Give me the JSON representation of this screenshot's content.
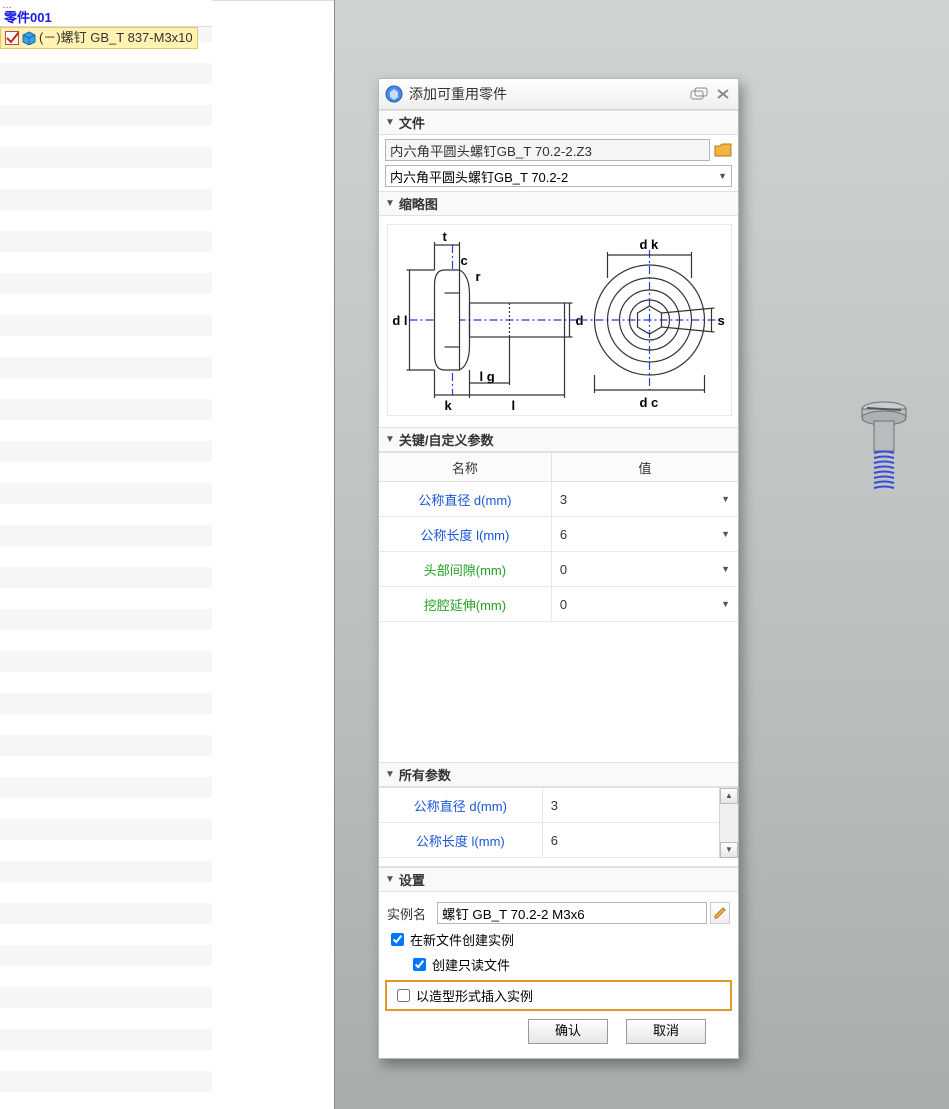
{
  "tree": {
    "root_label": "零件001",
    "item_label": "(－)螺钉 GB_T 837-M3x10"
  },
  "dialog": {
    "title": "添加可重用零件",
    "sections": {
      "file": "文件",
      "thumbnail": "缩略图",
      "key_params": "关键/自定义参数",
      "all_params": "所有参数",
      "settings": "设置"
    },
    "file_path": "内六角平圆头螺钉GB_T 70.2-2.Z3",
    "file_combo": "内六角平圆头螺钉GB_T 70.2-2",
    "columns": {
      "name": "名称",
      "value": "值"
    },
    "key_params": [
      {
        "name": "公称直径 d(mm)",
        "value": "3",
        "color": "blue",
        "dropdown": true
      },
      {
        "name": "公称长度 l(mm)",
        "value": "6",
        "color": "blue",
        "dropdown": true
      },
      {
        "name": "头部间隙(mm)",
        "value": "0",
        "color": "green",
        "dropdown": true
      },
      {
        "name": "挖腔延伸(mm)",
        "value": "0",
        "color": "green",
        "dropdown": true
      }
    ],
    "all_params": [
      {
        "name": "公称直径 d(mm)",
        "value": "3",
        "color": "blue"
      },
      {
        "name": "公称长度 l(mm)",
        "value": "6",
        "color": "blue"
      }
    ],
    "settings": {
      "instance_name_label": "实例名",
      "instance_name_value": "螺钉 GB_T 70.2-2 M3x6",
      "create_in_new_file": "在新文件创建实例",
      "create_readonly": "创建只读文件",
      "insert_as_shape": "以造型形式插入实例"
    },
    "buttons": {
      "ok": "确认",
      "cancel": "取消"
    }
  },
  "thumbnail_labels": {
    "t": "t",
    "c": "c",
    "r": "r",
    "dl": "d l",
    "k": "k",
    "lg": "l g",
    "l": "l",
    "d": "d",
    "dk": "d k",
    "dc": "d c",
    "s": "s"
  }
}
